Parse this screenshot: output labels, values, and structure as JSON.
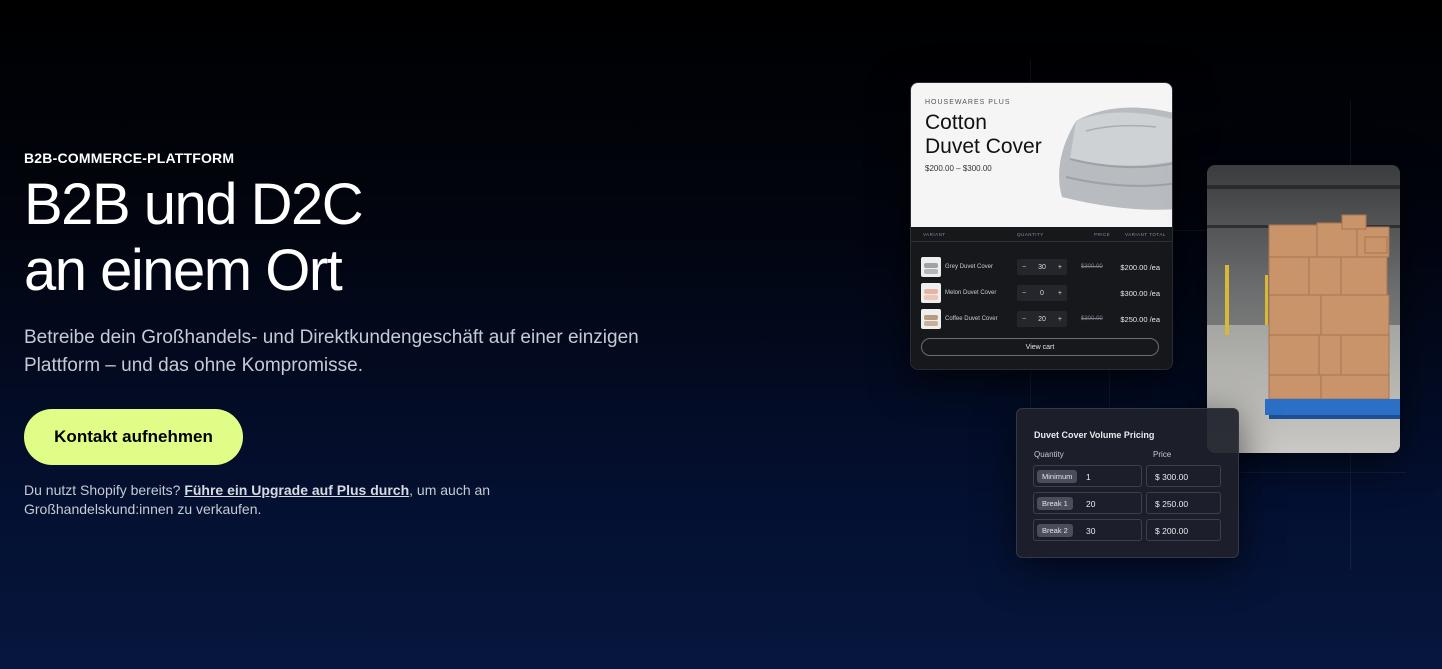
{
  "hero": {
    "eyebrow": "B2B-COMMERCE-PLATTFORM",
    "headline_line1": "B2B und D2C",
    "headline_line2": "an einem Ort",
    "subline": "Betreibe dein Großhandels- und Direktkundengeschäft auf einer einzigen Plattform – und das ohne Kompromisse.",
    "cta_label": "Kontakt aufnehmen",
    "note_prefix": "Du nutzt Shopify bereits?",
    "note_link": "Führe ein Upgrade auf Plus durch",
    "note_suffix": ", um auch an Großhandelskund:innen zu verkaufen."
  },
  "product_card": {
    "brand": "HOUSEWARES PLUS",
    "title_line1": "Cotton",
    "title_line2": "Duvet Cover",
    "price_range": "$200.00 – $300.00",
    "columns": [
      "VARIANT",
      "QUANTITY",
      "PRICE",
      "VARIANT TOTAL"
    ],
    "rows": [
      {
        "name": "Grey Duvet Cover",
        "qty": "30",
        "old_price": "$300.00",
        "price": "$200.00 /ea"
      },
      {
        "name": "Melon Duvet Cover",
        "qty": "0",
        "old_price": "",
        "price": "$300.00 /ea"
      },
      {
        "name": "Coffee Duvet Cover",
        "qty": "20",
        "old_price": "$300.00",
        "price": "$250.00 /ea"
      }
    ],
    "view_cart_label": "View cart"
  },
  "pricing_card": {
    "title": "Duvet Cover Volume Pricing",
    "col_quantity": "Quantity",
    "col_price": "Price",
    "rows": [
      {
        "tag": "Minimum",
        "qty": "1",
        "price": "$ 300.00"
      },
      {
        "tag": "Break 1",
        "qty": "20",
        "price": "$ 250.00"
      },
      {
        "tag": "Break 2",
        "qty": "30",
        "price": "$ 200.00"
      }
    ]
  },
  "colors": {
    "accent": "#e0fe87",
    "background_top": "#000000",
    "background_bottom": "#06163d"
  }
}
